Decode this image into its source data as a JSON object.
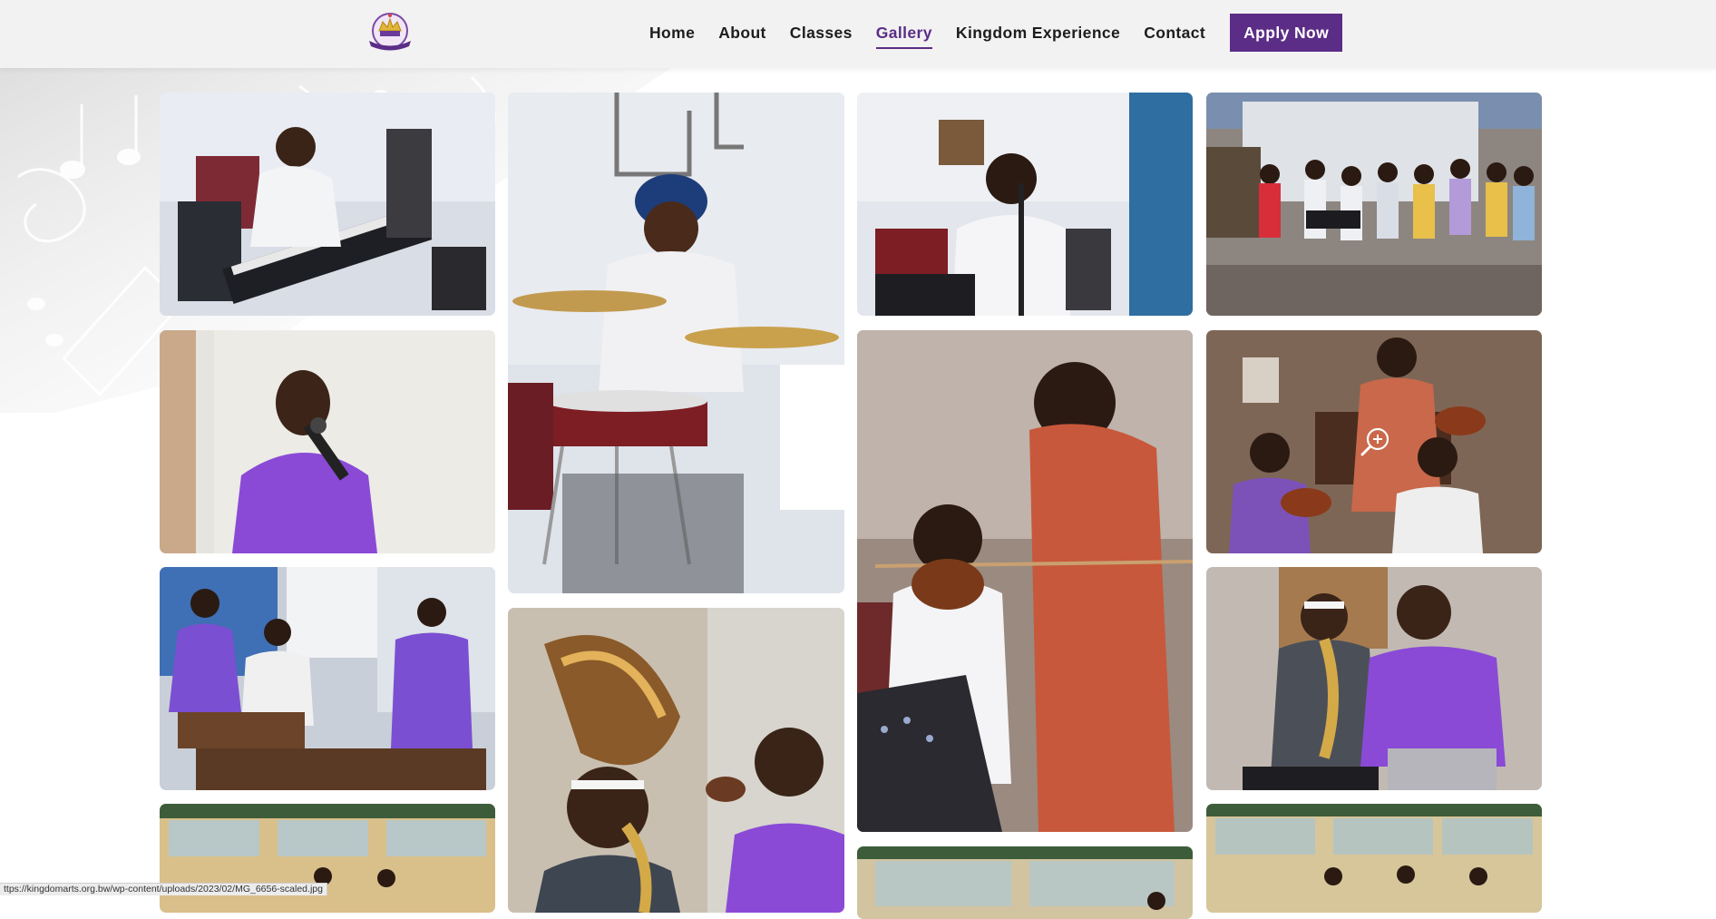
{
  "header": {
    "logo_alt": "Kingdom Arts logo",
    "nav": [
      {
        "label": "Home",
        "active": false
      },
      {
        "label": "About",
        "active": false
      },
      {
        "label": "Classes",
        "active": false
      },
      {
        "label": "Gallery",
        "active": true
      },
      {
        "label": "Kingdom Experience",
        "active": false
      },
      {
        "label": "Contact",
        "active": false
      }
    ],
    "cta_label": "Apply Now"
  },
  "colors": {
    "brand_purple": "#5b2d86",
    "header_bg": "#f2f2f2",
    "page_bg": "#ffffff"
  },
  "gallery": {
    "items": [
      {
        "subject": "boy playing keyboard"
      },
      {
        "subject": "boy playing drums"
      },
      {
        "subject": "girl singing at microphone"
      },
      {
        "subject": "group performing outdoors"
      },
      {
        "subject": "girl singing in purple shirt"
      },
      {
        "subject": "teacher helping violin student"
      },
      {
        "subject": "violin students in classroom"
      },
      {
        "subject": "marimba players"
      },
      {
        "subject": "smiling saxophone student"
      },
      {
        "subject": "saxophone lesson"
      },
      {
        "subject": "orchestra room"
      },
      {
        "subject": "classroom with windows"
      },
      {
        "subject": "string ensemble"
      }
    ],
    "hover_icon": "zoom-in-icon"
  },
  "status_bar": {
    "url": "ttps://kingdomarts.org.bw/wp-content/uploads/2023/02/MG_6656-scaled.jpg"
  }
}
